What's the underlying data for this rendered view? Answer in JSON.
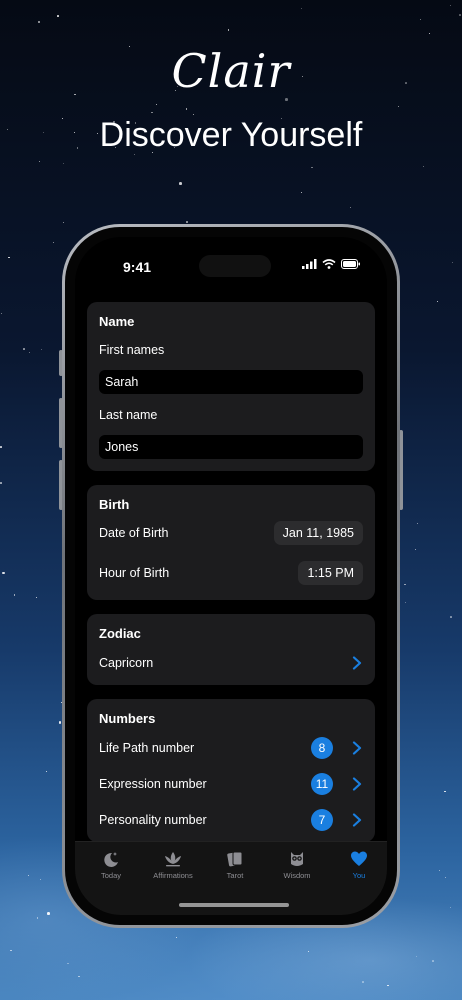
{
  "hero": {
    "title": "Clair",
    "subtitle": "Discover Yourself"
  },
  "status_bar": {
    "time": "9:41",
    "icons": [
      "signal-icon",
      "wifi-icon",
      "battery-icon"
    ]
  },
  "name_section": {
    "title": "Name",
    "first_label": "First names",
    "first_value": "Sarah",
    "last_label": "Last name",
    "last_value": "Jones"
  },
  "birth_section": {
    "title": "Birth",
    "date_label": "Date of Birth",
    "date_value": "Jan 11, 1985",
    "hour_label": "Hour of Birth",
    "hour_value": "1:15 PM"
  },
  "zodiac_section": {
    "title": "Zodiac",
    "sign": "Capricorn"
  },
  "numbers_section": {
    "title": "Numbers",
    "items": [
      {
        "label": "Life Path number",
        "value": "8"
      },
      {
        "label": "Expression number",
        "value": "11"
      },
      {
        "label": "Personality number",
        "value": "7"
      }
    ]
  },
  "tabbar": {
    "tabs": [
      {
        "label": "Today",
        "icon": "moon-stars-icon"
      },
      {
        "label": "Affirmations",
        "icon": "lotus-icon"
      },
      {
        "label": "Tarot",
        "icon": "tarot-cards-icon"
      },
      {
        "label": "Wisdom",
        "icon": "owl-icon"
      },
      {
        "label": "You",
        "icon": "heart-icon"
      }
    ],
    "active": "You"
  },
  "colors": {
    "accent": "#1a7fe0",
    "card": "#1c1c1e",
    "field": "#000000"
  }
}
